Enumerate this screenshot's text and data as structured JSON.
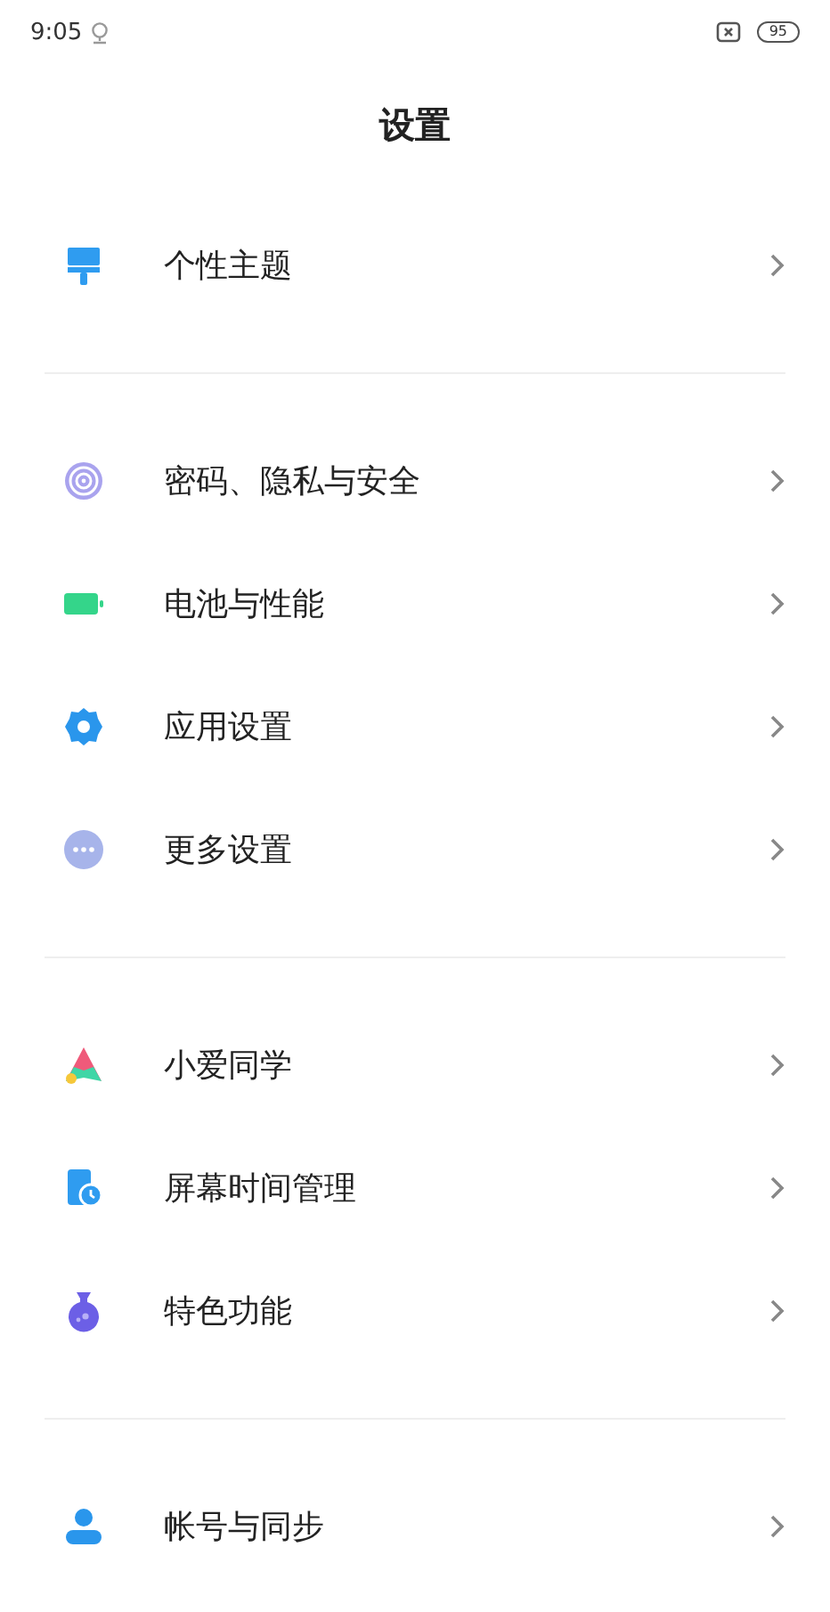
{
  "status_bar": {
    "time": "9:05",
    "battery": "95"
  },
  "title": "设置",
  "groups": [
    {
      "items": [
        {
          "label": "个性主题",
          "kind": "theme"
        }
      ]
    },
    {
      "items": [
        {
          "label": "密码、隐私与安全",
          "kind": "fingerprint"
        },
        {
          "label": "电池与性能",
          "kind": "battery"
        },
        {
          "label": "应用设置",
          "kind": "gear"
        },
        {
          "label": "更多设置",
          "kind": "more"
        }
      ]
    },
    {
      "items": [
        {
          "label": "小爱同学",
          "kind": "assistant"
        },
        {
          "label": "屏幕时间管理",
          "kind": "screentime"
        },
        {
          "label": "特色功能",
          "kind": "flask"
        }
      ]
    },
    {
      "items": [
        {
          "label": "帐号与同步",
          "kind": "account"
        }
      ]
    }
  ]
}
